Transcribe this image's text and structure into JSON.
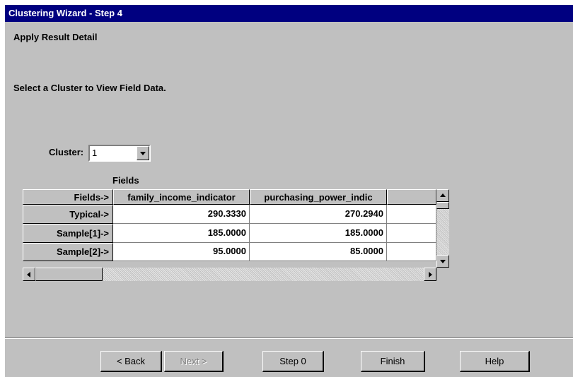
{
  "window": {
    "title": "Clustering Wizard - Step 4"
  },
  "page": {
    "heading": "Apply Result Detail",
    "instruction": "Select a Cluster to View Field Data."
  },
  "cluster": {
    "label": "Cluster:",
    "value": "1"
  },
  "grid": {
    "caption": "Fields",
    "corner": "Fields->",
    "columns": [
      "family_income_indicator",
      "purchasing_power_indic"
    ],
    "rows": [
      {
        "label": "Typical->",
        "values": [
          "290.3330",
          "270.2940"
        ]
      },
      {
        "label": "Sample[1]->",
        "values": [
          "185.0000",
          "185.0000"
        ]
      },
      {
        "label": "Sample[2]->",
        "values": [
          "95.0000",
          "85.0000"
        ]
      }
    ]
  },
  "buttons": {
    "back": "< Back",
    "next": "Next >",
    "step0": "Step 0",
    "finish": "Finish",
    "help": "Help"
  }
}
